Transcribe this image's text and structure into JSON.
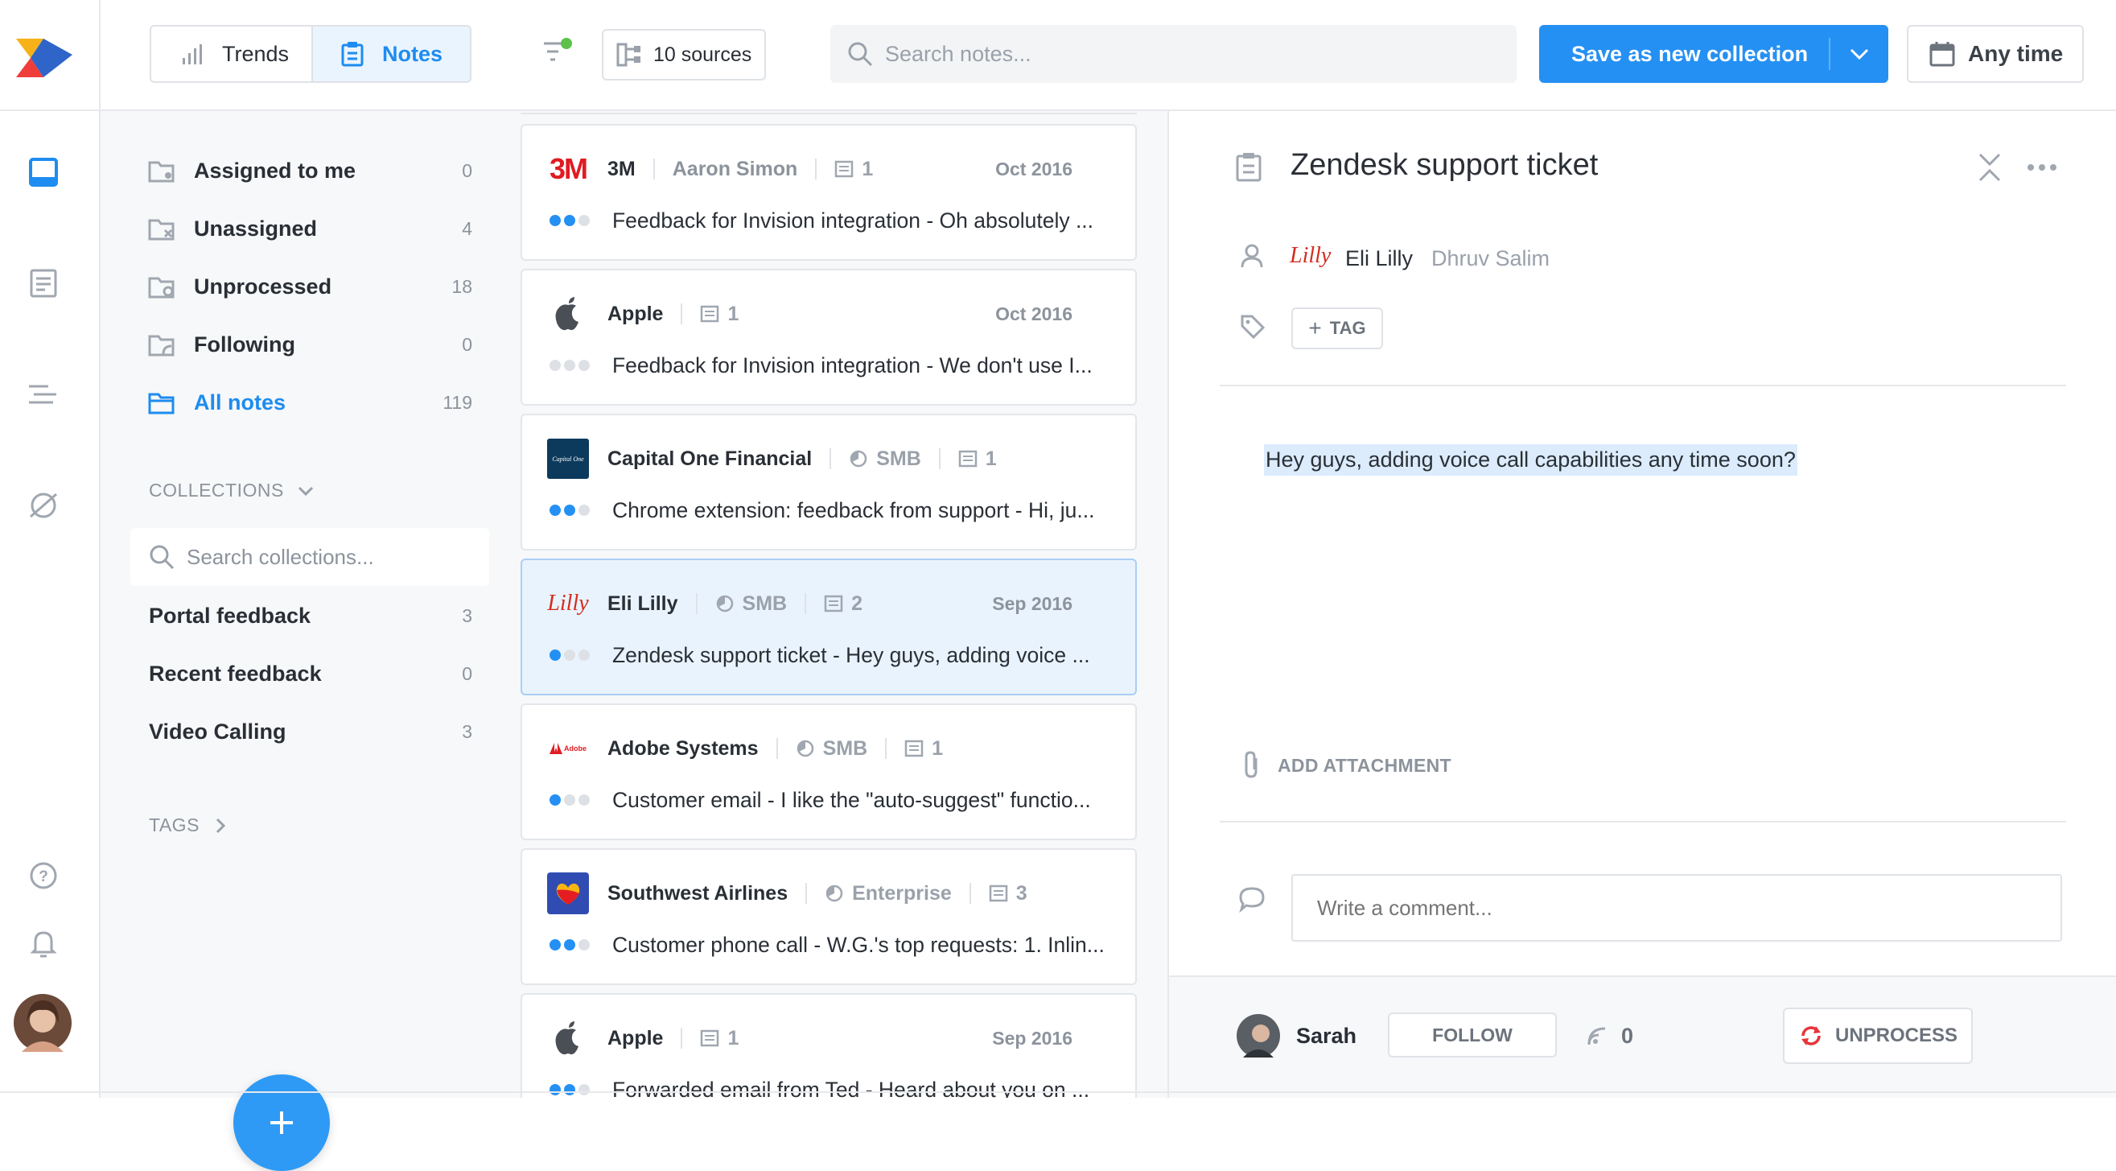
{
  "toolbar": {
    "tabs": [
      {
        "label": "Trends"
      },
      {
        "label": "Notes"
      }
    ],
    "sources_label": "10 sources",
    "search_placeholder": "Search notes...",
    "save_label": "Save as new collection",
    "time_label": "Any time"
  },
  "sidebar": {
    "items": [
      {
        "label": "Assigned to me",
        "count": "0"
      },
      {
        "label": "Unassigned",
        "count": "4"
      },
      {
        "label": "Unprocessed",
        "count": "18"
      },
      {
        "label": "Following",
        "count": "0"
      },
      {
        "label": "All notes",
        "count": "119"
      }
    ],
    "collections_heading": "COLLECTIONS",
    "search_collections_placeholder": "Search collections...",
    "collections": [
      {
        "label": "Portal feedback",
        "count": "3"
      },
      {
        "label": "Recent feedback",
        "count": "0"
      },
      {
        "label": "Video Calling",
        "count": "3"
      }
    ],
    "tags_heading": "TAGS"
  },
  "notes": [
    {
      "company": "3M",
      "person": "Aaron Simon",
      "segment": "",
      "count": "1",
      "date": "Oct 2016",
      "text": "Feedback for Invision integration - Oh absolutely ...",
      "dots": 2
    },
    {
      "company": "Apple",
      "person": "",
      "segment": "",
      "count": "1",
      "date": "Oct 2016",
      "text": "Feedback for Invision integration - We don't use I...",
      "dots": 0
    },
    {
      "company": "Capital One Financial",
      "person": "",
      "segment": "SMB",
      "count": "1",
      "date": "",
      "text": "Chrome extension: feedback from support - Hi, ju...",
      "dots": 2
    },
    {
      "company": "Eli Lilly",
      "person": "",
      "segment": "SMB",
      "count": "2",
      "date": "Sep 2016",
      "text": "Zendesk support ticket - Hey guys, adding voice ...",
      "dots": 1
    },
    {
      "company": "Adobe Systems",
      "person": "",
      "segment": "SMB",
      "count": "1",
      "date": "",
      "text": "Customer email - I like the \"auto-suggest\" functio...",
      "dots": 1
    },
    {
      "company": "Southwest Airlines",
      "person": "",
      "segment": "Enterprise",
      "count": "3",
      "date": "",
      "text": "Customer phone call - W.G.'s top requests: 1. Inlin...",
      "dots": 2
    },
    {
      "company": "Apple",
      "person": "",
      "segment": "",
      "count": "1",
      "date": "Sep 2016",
      "text": "Forwarded email from Ted - Heard about you on ...",
      "dots": 2
    }
  ],
  "logos": {
    "three_m": "3M",
    "lilly": "Lilly",
    "adobe": "Adobe",
    "capital_one": "Capital One"
  },
  "detail": {
    "title": "Zendesk support ticket",
    "company": "Eli Lilly",
    "owner": "Dhruv Salim",
    "tag_label": "TAG",
    "body": "Hey guys, adding voice call capabilities any time soon?",
    "attachment_label": "ADD ATTACHMENT",
    "comment_placeholder": "Write a comment...",
    "user": "Sarah",
    "follow_label": "FOLLOW",
    "signal_count": "0",
    "unprocess_label": "UNPROCESS"
  },
  "colors": {
    "accent": "#2590f3",
    "selected_bg": "#e9f3fd",
    "brand_red": "#e01b22"
  }
}
